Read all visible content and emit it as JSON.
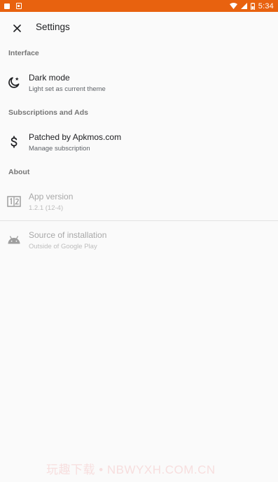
{
  "status_bar": {
    "time": "5:34",
    "color": "#e8620f"
  },
  "app_bar": {
    "title": "Settings",
    "close_icon": "close-icon"
  },
  "sections": {
    "interface": {
      "header": "Interface",
      "dark_mode": {
        "icon": "moon-star-icon",
        "title": "Dark mode",
        "subtitle": "Light set as current theme"
      }
    },
    "subscriptions": {
      "header": "Subscriptions and Ads",
      "subscription": {
        "icon": "dollar-icon",
        "title": "Patched by Apkmos.com",
        "subtitle": "Manage subscription"
      }
    },
    "about": {
      "header": "About",
      "app_version": {
        "icon": "version-number-icon",
        "title": "App version",
        "subtitle": "1.2.1 (12-4)"
      },
      "source": {
        "icon": "android-icon",
        "title": "Source of installation",
        "subtitle": "Outside of Google Play"
      }
    }
  },
  "watermark": "玩趣下载 • NBWYXH.COM.CN"
}
